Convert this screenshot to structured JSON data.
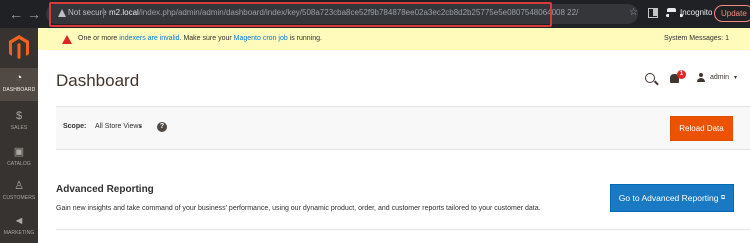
{
  "browser": {
    "back_glyph": "←",
    "forward_glyph": "→",
    "not_secure": "Not secure",
    "url_host": "m2.local",
    "url_path": "/index.php/admin/admin/dashboard/index/key/508a723cba8ce52f9b784878ee02a3ec2cb8d2b25775e5e0807548064008 22/",
    "star_glyph": "☆",
    "incognito_label": "Incognito",
    "update_label": "Update"
  },
  "sidebar": {
    "items": [
      {
        "label": "DASHBOARD",
        "glyph": "◔",
        "icon": "dashboard-icon"
      },
      {
        "label": "SALES",
        "glyph": "$",
        "icon": "dollar-icon"
      },
      {
        "label": "CATALOG",
        "glyph": "▣",
        "icon": "cube-icon"
      },
      {
        "label": "CUSTOMERS",
        "glyph": "♙",
        "icon": "person-icon"
      },
      {
        "label": "MARKETING",
        "glyph": "◄",
        "icon": "megaphone-icon"
      }
    ]
  },
  "message": {
    "text_before": "One or more ",
    "link_indexers": "indexers are invalid",
    "text_middle": ". Make sure your ",
    "link_cron": "Magento cron job",
    "text_after": " is running.",
    "system_messages": "System Messages: 1"
  },
  "header": {
    "title": "Dashboard",
    "notification_count": "1",
    "user_name": "admin",
    "user_caret": "▾"
  },
  "scope": {
    "label": "Scope:",
    "value": "All Store Views",
    "caret": "▾",
    "help": "?",
    "reload_label": "Reload Data"
  },
  "advanced_reporting": {
    "title": "Advanced Reporting",
    "description": "Gain new insights and take command of your business' performance, using our dynamic product, order, and customer reports tailored to your customer data.",
    "button_label": "Go to Advanced Reporting",
    "button_icon": "⧉"
  },
  "colors": {
    "sidebar_bg": "#373330",
    "accent_orange": "#eb5202",
    "primary_blue": "#1979c3",
    "message_bg": "#fffbbb"
  }
}
